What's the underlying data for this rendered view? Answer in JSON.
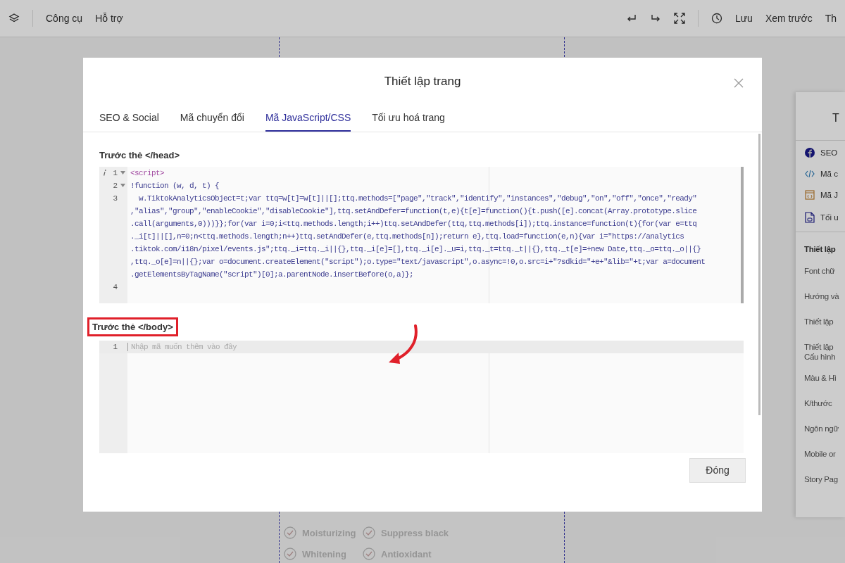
{
  "toolbar": {
    "menu": [
      {
        "label": "Công cụ"
      },
      {
        "label": "Hỗ trợ"
      }
    ],
    "actions": [
      {
        "label": "Lưu"
      },
      {
        "label": "Xem trước"
      },
      {
        "label": "Th"
      }
    ]
  },
  "canvas_features": [
    {
      "label": "Moisturizing"
    },
    {
      "label": "Suppress black"
    },
    {
      "label": "Whitening"
    },
    {
      "label": "Antioxidant"
    }
  ],
  "side_panel": {
    "title": "T",
    "links": [
      {
        "kind": "facebook",
        "label": "SEO"
      },
      {
        "kind": "code",
        "label": "Mã c"
      },
      {
        "kind": "window",
        "label": "Mã J"
      },
      {
        "kind": "file",
        "label": "Tối u"
      }
    ],
    "section_title": "Thiết lập",
    "items": [
      "Font chữ",
      "Hướng và",
      "Thiết lập",
      "Thiết lập\nCấu hình",
      "Màu & Hì",
      "K/thước",
      "Ngôn ngữ",
      "Mobile or",
      "Story Pag"
    ]
  },
  "modal": {
    "title": "Thiết lập trang",
    "tabs": [
      {
        "label": "SEO & Social",
        "selected": false
      },
      {
        "label": "Mã chuyển đổi",
        "selected": false
      },
      {
        "label": "Mã JavaScript/CSS",
        "selected": true
      },
      {
        "label": "Tối ưu hoá trang",
        "selected": false
      }
    ],
    "head_section": {
      "label": "Trước thẻ </head>",
      "lines": [
        {
          "number": "1",
          "info": true,
          "foldable": true,
          "kind": "tag",
          "text": "<script>"
        },
        {
          "number": "2",
          "info": false,
          "foldable": true,
          "kind": "code",
          "text": "!function (w, d, t) {"
        },
        {
          "number": "3",
          "info": false,
          "foldable": false,
          "kind": "code",
          "text": "  w.TiktokAnalyticsObject=t;var ttq=w[t]=w[t]||[];ttq.methods=[\"page\",\"track\",\"identify\",\"instances\",\"debug\",\"on\",\"off\",\"once\",\"ready\""
        },
        {
          "info": false,
          "foldable": false,
          "kind": "code",
          "text": ",\"alias\",\"group\",\"enableCookie\",\"disableCookie\"],ttq.setAndDefer=function(t,e){t[e]=function(){t.push([e].concat(Array.prototype.slice"
        },
        {
          "info": false,
          "foldable": false,
          "kind": "code",
          "text": ".call(arguments,0)))}};for(var i=0;i<ttq.methods.length;i++)ttq.setAndDefer(ttq,ttq.methods[i]);ttq.instance=function(t){for(var e=ttq"
        },
        {
          "info": false,
          "foldable": false,
          "kind": "code",
          "text": "._i[t]||[],n=0;n<ttq.methods.length;n++)ttq.setAndDefer(e,ttq.methods[n]);return e},ttq.load=function(e,n){var i=\"https://analytics"
        },
        {
          "info": false,
          "foldable": false,
          "kind": "code",
          "text": ".tiktok.com/i18n/pixel/events.js\";ttq._i=ttq._i||{},ttq._i[e]=[],ttq._i[e]._u=i,ttq._t=ttq._t||{},ttq._t[e]=+new Date,ttq._o=ttq._o||{}"
        },
        {
          "info": false,
          "foldable": false,
          "kind": "code",
          "text": ",ttq._o[e]=n||{};var o=document.createElement(\"script\");o.type=\"text/javascript\",o.async=!0,o.src=i+\"?sdkid=\"+e+\"&lib=\"+t;var a=document"
        },
        {
          "info": false,
          "foldable": false,
          "kind": "code",
          "text": ".getElementsByTagName(\"script\")[0];a.parentNode.insertBefore(o,a)};"
        },
        {
          "number": "4",
          "info": false,
          "foldable": false
        }
      ]
    },
    "body_section": {
      "label": "Trước thẻ </body>",
      "highlighted": true,
      "line_number": "1",
      "placeholder": "Nhập mã muốn thêm vào đây"
    },
    "close_button": "Đóng"
  }
}
